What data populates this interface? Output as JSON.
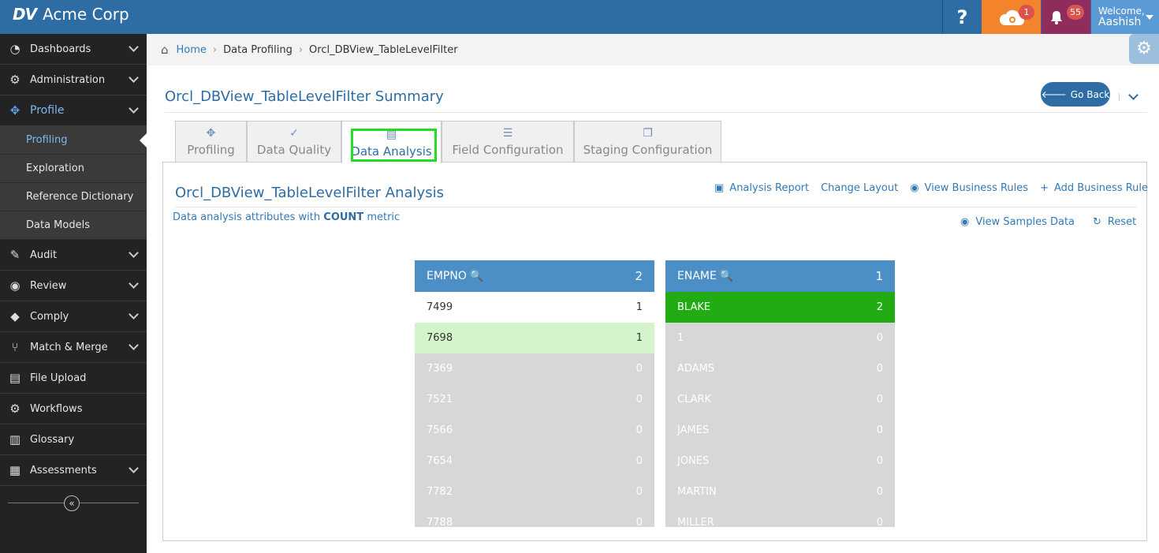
{
  "app": {
    "logo_mark": "DV",
    "name": "Acme Corp"
  },
  "topbar": {
    "help_icon": "?",
    "cloud_badge": "1",
    "bell_badge": "55",
    "welcome": "Welcome,",
    "user": "Aashish"
  },
  "sidebar": {
    "items": [
      {
        "label": "Dashboards",
        "icon": "dashboard-icon"
      },
      {
        "label": "Administration",
        "icon": "gears-icon"
      },
      {
        "label": "Profile",
        "icon": "crosshair-icon"
      }
    ],
    "sub_items": [
      "Profiling",
      "Exploration",
      "Reference Dictionary",
      "Data Models"
    ],
    "items2": [
      {
        "label": "Audit"
      },
      {
        "label": "Review"
      },
      {
        "label": "Comply"
      },
      {
        "label": "Match & Merge"
      },
      {
        "label": "File Upload"
      },
      {
        "label": "Workflows"
      },
      {
        "label": "Glossary"
      },
      {
        "label": "Assessments"
      }
    ]
  },
  "breadcrumb": {
    "home": "Home",
    "level1": "Data Profiling",
    "level2": "Orcl_DBView_TableLevelFilter"
  },
  "page": {
    "title": "Orcl_DBView_TableLevelFilter Summary",
    "go_back": "Go Back"
  },
  "tabs": [
    "Profiling",
    "Data Quality",
    "Data Analysis",
    "Field Configuration",
    "Staging Configuration"
  ],
  "analysis": {
    "title": "Orcl_DBView_TableLevelFilter Analysis",
    "actions": [
      "Analysis Report",
      "Change Layout",
      "View Business Rules",
      "Add Business Rule"
    ],
    "desc_prefix": "Data analysis attributes with",
    "desc_metric": "COUNT",
    "desc_suffix": "metric",
    "view_samples": "View Samples Data",
    "reset": "Reset"
  },
  "columns": [
    {
      "name": "EMPNO",
      "count": "2",
      "rows": [
        [
          "7499",
          "1"
        ],
        [
          "7698",
          "1"
        ],
        [
          "7369",
          "0"
        ],
        [
          "7521",
          "0"
        ],
        [
          "7566",
          "0"
        ],
        [
          "7654",
          "0"
        ],
        [
          "7782",
          "0"
        ],
        [
          "7788",
          "0"
        ]
      ]
    },
    {
      "name": "ENAME",
      "count": "1",
      "rows": [
        [
          "BLAKE",
          "2"
        ],
        [
          "1",
          "0"
        ],
        [
          "ADAMS",
          "0"
        ],
        [
          "CLARK",
          "0"
        ],
        [
          "JAMES",
          "0"
        ],
        [
          "JONES",
          "0"
        ],
        [
          "MARTIN",
          "0"
        ],
        [
          "MILLER",
          "0"
        ]
      ]
    }
  ],
  "colors": {
    "primary": "#2e6da4",
    "green": "#21ac13",
    "light_green": "#d4f5cc",
    "header_blue": "#4b8fc6"
  }
}
